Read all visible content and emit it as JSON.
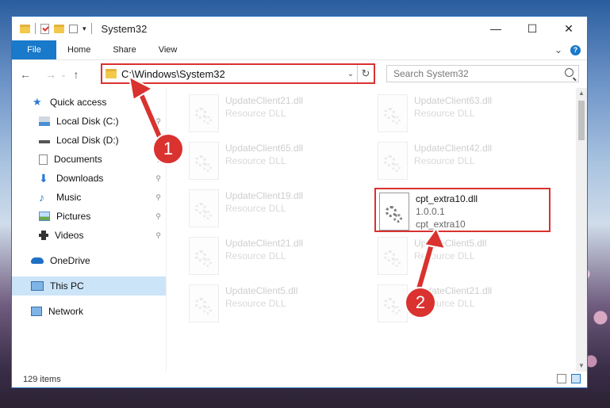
{
  "window": {
    "title": "System32",
    "controls": {
      "minimize": "—",
      "maximize": "☐",
      "close": "✕"
    }
  },
  "ribbon": {
    "tabs": [
      "File",
      "Home",
      "Share",
      "View"
    ],
    "help": "?",
    "collapse": "⌄"
  },
  "navigation": {
    "back": "←",
    "forward": "→",
    "recent": "⌄",
    "up": "↑",
    "address": "C:\\Windows\\System32",
    "address_dropdown": "⌄",
    "refresh": "↻",
    "search_placeholder": "Search System32"
  },
  "sidebar": {
    "items": [
      {
        "label": "Quick access",
        "icon": "star-icon"
      },
      {
        "label": "Local Disk (C:)",
        "icon": "drive-icon"
      },
      {
        "label": "Local Disk (D:)",
        "icon": "drive-icon"
      },
      {
        "label": "Documents",
        "icon": "documents-icon"
      },
      {
        "label": "Downloads",
        "icon": "download-icon"
      },
      {
        "label": "Music",
        "icon": "music-icon"
      },
      {
        "label": "Pictures",
        "icon": "pictures-icon"
      },
      {
        "label": "Videos",
        "icon": "videos-icon"
      },
      {
        "label": "OneDrive",
        "icon": "cloud-icon"
      },
      {
        "label": "This PC",
        "icon": "computer-icon"
      },
      {
        "label": "Network",
        "icon": "network-icon"
      }
    ],
    "pin": "📌"
  },
  "files": [
    {
      "name": "UpdateClient21.dll",
      "type": "Resource DLL"
    },
    {
      "name": "UpdateClient63.dll",
      "type": "Resource DLL"
    },
    {
      "name": "UpdateClient65.dll",
      "type": "Resource DLL"
    },
    {
      "name": "UpdateClient42.dll",
      "type": "Resource DLL"
    },
    {
      "name": "UpdateClient19.dll",
      "type": "Resource DLL"
    },
    {
      "name": "cpt_extra10.dll",
      "version": "1.0.0.1",
      "type": "cpt_extra10"
    },
    {
      "name": "UpdateClient21.dll",
      "type": "Resource DLL"
    },
    {
      "name": "UpdateClient5.dll",
      "type": "Resource DLL"
    },
    {
      "name": "UpdateClient5.dll",
      "type": "Resource DLL"
    },
    {
      "name": "UpdateClient21.dll",
      "type": "Resource DLL"
    }
  ],
  "status": {
    "item_count": "129 items"
  },
  "callouts": [
    "1",
    "2"
  ],
  "colors": {
    "accent": "#1979ca",
    "highlight": "#d9322f"
  }
}
